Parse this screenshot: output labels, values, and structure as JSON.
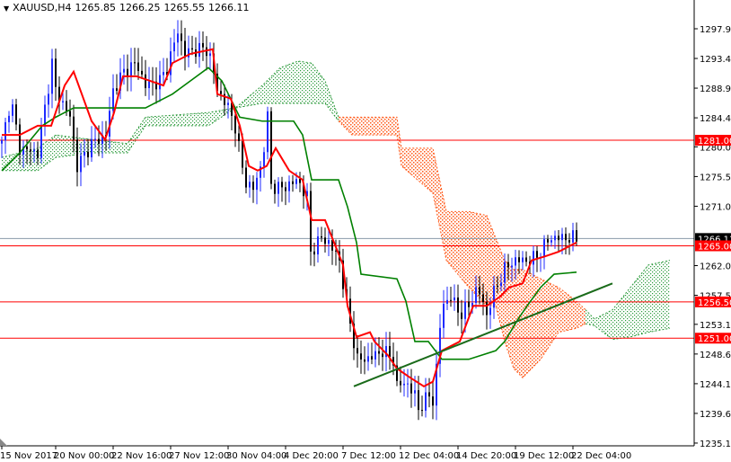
{
  "header": {
    "symbol": "XAUUSD,H4",
    "open": "1265.85",
    "high": "1266.25",
    "low": "1265.55",
    "close": "1266.11"
  },
  "colors": {
    "bull_candle": "#1f2bff",
    "bear_candle": "#000000",
    "tenkan": "#ff0000",
    "kijun": "#008000",
    "cloud_bull": "#2a9a3a",
    "cloud_bear": "#ff5a1a",
    "level": "#ff0000",
    "trendline": "#1a6b1a",
    "bid_line": "#8899aa"
  },
  "chart_data": {
    "type": "candlestick",
    "title": "XAUUSD,H4",
    "ylim": [
      1235.1,
      1297.9
    ],
    "y_ticks": [
      "1297.90",
      "1293.40",
      "1288.90",
      "1284.40",
      "1280.00",
      "1275.50",
      "1271.00",
      "1262.00",
      "1257.50",
      "1253.10",
      "1248.60",
      "1244.10",
      "1239.60",
      "1235.10"
    ],
    "x_ticks": [
      {
        "bar": 0,
        "label": "15 Nov 2017"
      },
      {
        "bar": 15,
        "label": "20 Nov 00:00"
      },
      {
        "bar": 31,
        "label": "22 Nov 16:00"
      },
      {
        "bar": 47,
        "label": "27 Nov 12:00"
      },
      {
        "bar": 63,
        "label": "30 Nov 04:00"
      },
      {
        "bar": 79,
        "label": "4 Dec 20:00"
      },
      {
        "bar": 95,
        "label": "7 Dec 12:00"
      },
      {
        "bar": 111,
        "label": "12 Dec 04:00"
      },
      {
        "bar": 127,
        "label": "14 Dec 20:00"
      },
      {
        "bar": 143,
        "label": "19 Dec 12:00"
      },
      {
        "bar": 159,
        "label": "22 Dec 04:00"
      }
    ],
    "close_path": [
      [
        0,
        1280.5
      ],
      [
        2.5,
        1287.3
      ],
      [
        5,
        1279.8
      ],
      [
        10,
        1279.1
      ],
      [
        14,
        1292.7
      ],
      [
        15,
        1288.6
      ],
      [
        19,
        1284.5
      ],
      [
        21,
        1277.1
      ],
      [
        25,
        1280.5
      ],
      [
        29,
        1281.8
      ],
      [
        31,
        1288.6
      ],
      [
        34,
        1291.4
      ],
      [
        37.5,
        1292.7
      ],
      [
        40,
        1289.3
      ],
      [
        44,
        1290.0
      ],
      [
        46,
        1292.0
      ],
      [
        49,
        1297.5
      ],
      [
        51,
        1294.1
      ],
      [
        54,
        1294.8
      ],
      [
        57.5,
        1294.8
      ],
      [
        60,
        1288.6
      ],
      [
        62.5,
        1286.6
      ],
      [
        65,
        1283.2
      ],
      [
        67.5,
        1275.0
      ],
      [
        70,
        1273.6
      ],
      [
        72.5,
        1277.7
      ],
      [
        74,
        1284.5
      ],
      [
        75,
        1274.3
      ],
      [
        77.5,
        1273.6
      ],
      [
        80,
        1274.3
      ],
      [
        82.5,
        1275.0
      ],
      [
        85,
        1272.3
      ],
      [
        86,
        1264.1
      ],
      [
        89,
        1266.2
      ],
      [
        91,
        1265.5
      ],
      [
        94,
        1262.8
      ],
      [
        96,
        1255.9
      ],
      [
        97.5,
        1251.9
      ],
      [
        99,
        1247.8
      ],
      [
        101,
        1247.8
      ],
      [
        104,
        1248.4
      ],
      [
        106,
        1249.1
      ],
      [
        109,
        1247.8
      ],
      [
        110,
        1243.7
      ],
      [
        112.5,
        1244.4
      ],
      [
        115,
        1242.3
      ],
      [
        116,
        1240.3
      ],
      [
        119,
        1242.3
      ],
      [
        120,
        1241.6
      ],
      [
        121,
        1246.4
      ],
      [
        122.5,
        1255.9
      ],
      [
        125,
        1257.3
      ],
      [
        127.5,
        1254.6
      ],
      [
        130,
        1255.9
      ],
      [
        132.5,
        1258.7
      ],
      [
        135,
        1254.6
      ],
      [
        137.5,
        1258.7
      ],
      [
        140,
        1261.4
      ],
      [
        142.5,
        1262.8
      ],
      [
        145,
        1262.8
      ],
      [
        147.5,
        1262.8
      ],
      [
        150,
        1264.1
      ],
      [
        152.5,
        1266.2
      ],
      [
        155,
        1266.2
      ],
      [
        157.5,
        1266.2
      ],
      [
        160,
        1266.1
      ]
    ],
    "tenkan_sen": [
      [
        0,
        1281.8
      ],
      [
        5,
        1281.8
      ],
      [
        10,
        1283.2
      ],
      [
        13.75,
        1283.2
      ],
      [
        17.5,
        1289.3
      ],
      [
        20,
        1291.4
      ],
      [
        25,
        1283.9
      ],
      [
        28.75,
        1281.1
      ],
      [
        31.25,
        1285.2
      ],
      [
        33.75,
        1290.7
      ],
      [
        37.5,
        1290.7
      ],
      [
        41.25,
        1290.0
      ],
      [
        45,
        1289.3
      ],
      [
        47.5,
        1292.7
      ],
      [
        52.5,
        1294.1
      ],
      [
        58.75,
        1294.8
      ],
      [
        60,
        1288.0
      ],
      [
        63.75,
        1287.3
      ],
      [
        66.25,
        1283.2
      ],
      [
        68.75,
        1277.1
      ],
      [
        71.25,
        1276.4
      ],
      [
        73.75,
        1277.1
      ],
      [
        76.25,
        1279.8
      ],
      [
        80,
        1276.4
      ],
      [
        83.75,
        1275.0
      ],
      [
        86.25,
        1268.9
      ],
      [
        90,
        1268.9
      ],
      [
        92.5,
        1265.5
      ],
      [
        95,
        1262.1
      ],
      [
        96.25,
        1255.9
      ],
      [
        98.75,
        1251.2
      ],
      [
        102.5,
        1251.9
      ],
      [
        103.75,
        1250.5
      ],
      [
        107.5,
        1248.4
      ],
      [
        110,
        1246.4
      ],
      [
        113.75,
        1245.0
      ],
      [
        117.5,
        1243.7
      ],
      [
        120,
        1244.4
      ],
      [
        122.5,
        1249.1
      ],
      [
        125,
        1249.8
      ],
      [
        127.5,
        1250.5
      ],
      [
        131.25,
        1255.9
      ],
      [
        135,
        1255.9
      ],
      [
        138.75,
        1257.3
      ],
      [
        141.25,
        1258.7
      ],
      [
        145,
        1259.3
      ],
      [
        147.5,
        1262.8
      ],
      [
        151.25,
        1263.4
      ],
      [
        155,
        1264.1
      ],
      [
        160,
        1265.5
      ]
    ],
    "kijun_sen": [
      [
        0,
        1276.4
      ],
      [
        5,
        1279.1
      ],
      [
        11.25,
        1283.2
      ],
      [
        15,
        1284.5
      ],
      [
        20,
        1285.9
      ],
      [
        40,
        1285.9
      ],
      [
        47.5,
        1288.0
      ],
      [
        52.5,
        1290.0
      ],
      [
        57.5,
        1292.0
      ],
      [
        61.25,
        1290.0
      ],
      [
        66.25,
        1284.5
      ],
      [
        72.5,
        1283.9
      ],
      [
        81.25,
        1283.9
      ],
      [
        83.75,
        1281.8
      ],
      [
        86.25,
        1275.0
      ],
      [
        93.75,
        1275.0
      ],
      [
        96.25,
        1270.9
      ],
      [
        98.75,
        1265.5
      ],
      [
        100,
        1260.7
      ],
      [
        110,
        1260.0
      ],
      [
        112.5,
        1256.6
      ],
      [
        115,
        1250.5
      ],
      [
        118.75,
        1250.5
      ],
      [
        122.5,
        1247.8
      ],
      [
        130,
        1247.8
      ],
      [
        137.5,
        1249.1
      ],
      [
        140,
        1250.5
      ],
      [
        143.75,
        1253.9
      ],
      [
        146.25,
        1255.9
      ],
      [
        150,
        1258.7
      ],
      [
        153.75,
        1260.7
      ],
      [
        160,
        1261.0
      ]
    ],
    "cloud": [
      [
        0,
        1278.4,
        1276.4
      ],
      [
        10,
        1279.8,
        1276.4
      ],
      [
        15,
        1281.8,
        1278.4
      ],
      [
        25,
        1281.1,
        1279.1
      ],
      [
        35,
        1280.5,
        1279.1
      ],
      [
        40,
        1284.5,
        1283.2
      ],
      [
        57.5,
        1285.2,
        1283.2
      ],
      [
        65,
        1285.9,
        1285.9
      ],
      [
        72.5,
        1289.3,
        1286.6
      ],
      [
        77.5,
        1292.0,
        1286.6
      ],
      [
        82.5,
        1293.0,
        1286.6
      ],
      [
        86.25,
        1292.7,
        1286.6
      ],
      [
        90,
        1290.0,
        1286.6
      ],
      [
        93.75,
        1284.5,
        1283.9
      ],
      [
        97.5,
        1284.5,
        1281.8
      ],
      [
        110,
        1284.5,
        1281.8
      ],
      [
        111.25,
        1279.8,
        1277.1
      ],
      [
        120,
        1279.8,
        1273.0
      ],
      [
        123.75,
        1270.2,
        1262.8
      ],
      [
        130,
        1270.2,
        1258.7
      ],
      [
        135,
        1269.6,
        1255.9
      ],
      [
        137.5,
        1266.2,
        1255.9
      ],
      [
        140,
        1262.8,
        1250.5
      ],
      [
        142.5,
        1261.4,
        1246.4
      ],
      [
        145,
        1261.4,
        1245.0
      ],
      [
        150,
        1260.0,
        1247.8
      ],
      [
        155,
        1258.7,
        1251.9
      ],
      [
        160,
        1256.6,
        1252.5
      ],
      [
        162.5,
        1255.3,
        1253.2
      ],
      [
        165,
        1253.9,
        1252.9
      ],
      [
        170,
        1255.3,
        1250.8
      ],
      [
        175,
        1258.7,
        1251.2
      ],
      [
        180,
        1262.1,
        1251.9
      ],
      [
        186,
        1262.8,
        1252.5
      ]
    ],
    "cloud_bearish_range": [
      93.75,
      162.5
    ],
    "trendline": [
      [
        98,
        1243.7
      ],
      [
        170,
        1259.3
      ]
    ],
    "levels": [
      {
        "price": 1281.0,
        "label": "1281.00"
      },
      {
        "price": 1265.0,
        "label": "1265.00"
      },
      {
        "price": 1256.5,
        "label": "1256.50"
      },
      {
        "price": 1251.0,
        "label": "1251.00"
      }
    ],
    "current_price": {
      "price": 1266.11,
      "label": "1266.11"
    }
  }
}
